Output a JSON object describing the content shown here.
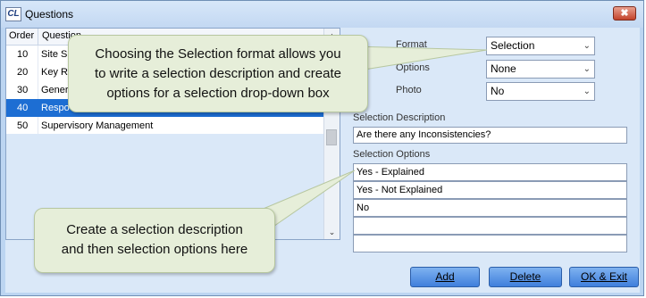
{
  "window": {
    "title": "Questions",
    "app_icon": "CL",
    "close_label": "✖"
  },
  "list": {
    "headers": [
      "Order",
      "Question"
    ],
    "rows": [
      {
        "order": "10",
        "question": "Site Su"
      },
      {
        "order": "20",
        "question": "Key R"
      },
      {
        "order": "30",
        "question": "Gener"
      },
      {
        "order": "40",
        "question": "Respo",
        "selected": true
      },
      {
        "order": "50",
        "question": "Supervisory Management"
      }
    ]
  },
  "form": {
    "format_label": "Format",
    "format_value": "Selection",
    "options_label": "Options",
    "options_value": "None",
    "photo_label": "Photo",
    "photo_value": "No",
    "selection_description_label": "Selection Description",
    "selection_description_value": "Are there any Inconsistencies?",
    "selection_options_label": "Selection Options",
    "selection_options": [
      "Yes - Explained",
      "Yes - Not Explained",
      "No",
      "",
      ""
    ]
  },
  "buttons": {
    "add": "Add",
    "delete": "Delete",
    "ok_exit": "OK & Exit"
  },
  "callouts": {
    "top": "Choosing the Selection format allows you\nto write a selection description and create\noptions for a selection drop-down box",
    "bottom": "Create a selection description\nand then selection options here"
  },
  "colors": {
    "selection_highlight": "#1d6ed3",
    "callout_fill": "#e6eed9",
    "button": "#3f7fdc",
    "window_bg": "#dae8f8"
  }
}
